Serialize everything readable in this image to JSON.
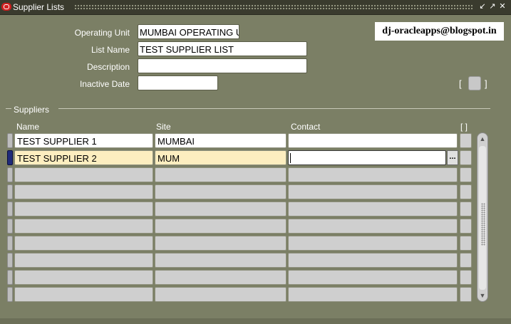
{
  "window": {
    "title": "Supplier Lists"
  },
  "form": {
    "operating_unit_label": "Operating Unit",
    "operating_unit_value": "MUMBAI OPERATING U",
    "list_name_label": "List Name",
    "list_name_value": "TEST SUPPLIER LIST",
    "description_label": "Description",
    "description_value": "",
    "inactive_date_label": "Inactive Date",
    "inactive_date_value": ""
  },
  "watermark": "dj-oracleapps@blogspot.in",
  "bracket_open": "[",
  "bracket_close": "]",
  "suppliers": {
    "title": "Suppliers",
    "columns": {
      "name": "Name",
      "site": "Site",
      "contact": "Contact",
      "extra": "[ ]"
    },
    "rows": [
      {
        "name": "TEST SUPPLIER 1",
        "site": "MUMBAI",
        "contact": ""
      },
      {
        "name": "TEST SUPPLIER 2",
        "site": "MUM",
        "contact": ""
      }
    ],
    "lov_label": "..."
  }
}
